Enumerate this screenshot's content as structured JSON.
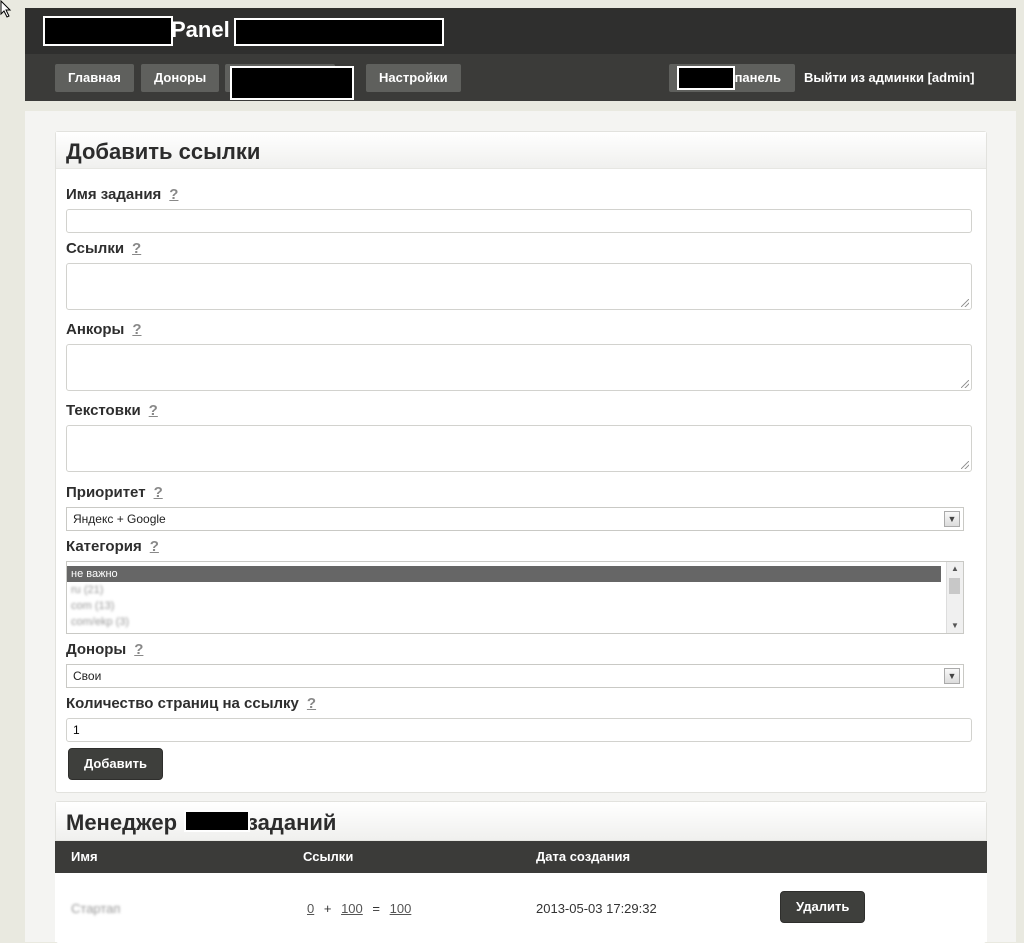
{
  "header": {
    "title": "Panel",
    "nav": [
      {
        "label": "Главная"
      },
      {
        "label": "Доноры"
      },
      {
        "label": ""
      },
      {
        "label": "Настройки"
      }
    ],
    "panel_link": "панель",
    "logout": "Выйти из админки [admin]"
  },
  "add_form": {
    "heading": "Добавить ссылки",
    "help_mark": "?",
    "fields": {
      "task_name": {
        "label": "Имя задания",
        "value": ""
      },
      "links": {
        "label": "Ссылки",
        "value": ""
      },
      "anchors": {
        "label": "Анкоры",
        "value": ""
      },
      "texts": {
        "label": "Текстовки",
        "value": ""
      },
      "priority": {
        "label": "Приоритет",
        "value": "Яндекс + Google"
      },
      "category": {
        "label": "Категория",
        "options": [
          "не важно",
          "ru (21)",
          "com (13)",
          "com/ekp (3)"
        ],
        "selected": "не важно"
      },
      "donors": {
        "label": "Доноры",
        "value": "Свои"
      },
      "pages_per_link": {
        "label": "Количество страниц на ссылку",
        "value": "1"
      }
    },
    "submit": "Добавить"
  },
  "manager": {
    "heading_left": "Менеджер",
    "heading_right": "заданий",
    "columns": [
      "Имя",
      "Ссылки",
      "Дата создания"
    ],
    "rows": [
      {
        "name": "Стартап",
        "links_a": "0",
        "op_plus": "+",
        "links_b": "100",
        "op_eq": "=",
        "links_total": "100",
        "created": "2013-05-03 17:29:32",
        "delete": "Удалить"
      }
    ]
  }
}
